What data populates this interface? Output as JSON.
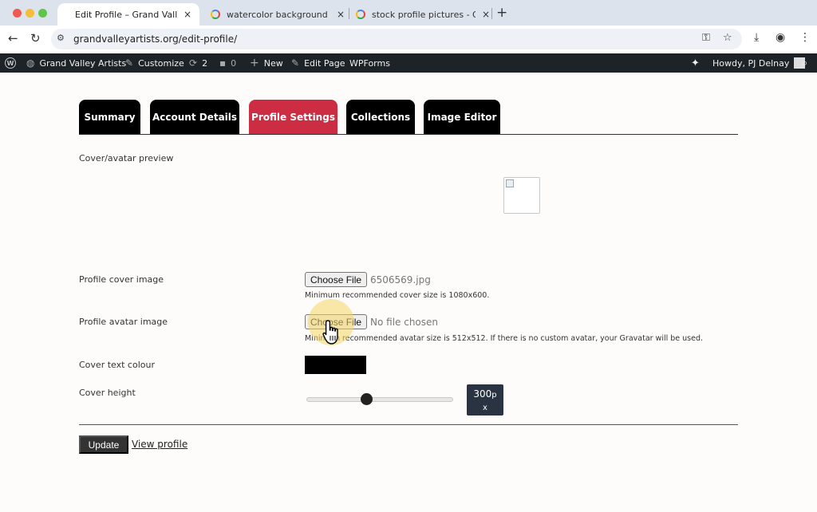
{
  "browser": {
    "tabs": [
      {
        "title": "Edit Profile – Grand Valley Artists",
        "close": "×"
      },
      {
        "title": "watercolor background images",
        "close": "×"
      },
      {
        "title": "stock profile pictures - Google",
        "close": "×"
      }
    ],
    "new_tab": "+",
    "url": "grandvalleyartists.org/edit-profile/",
    "icons": {
      "back": "←",
      "reload": "↻",
      "site_info": "⚙",
      "key": "⚿",
      "star": "☆",
      "download": "⤓",
      "profile": "◉",
      "menu": "⋮"
    }
  },
  "adminbar": {
    "site_name": "Grand Valley Artists",
    "customize": "Customize",
    "updates_count": "2",
    "comments_count": "0",
    "new": "New",
    "edit_page": "Edit Page",
    "wpforms": "WPForms",
    "howdy": "Howdy, PJ Delnay",
    "icons": {
      "wp": "W",
      "dashboard": "◍",
      "brush": "✎",
      "updates": "⟳",
      "comments": "▪",
      "plus": "+",
      "pencil": "✎",
      "sparkle": "✦",
      "search": "⌕"
    }
  },
  "profile_tabs": [
    {
      "label": "Summary",
      "active": false
    },
    {
      "label": "Account Details",
      "active": false
    },
    {
      "label": "Profile Settings",
      "active": true
    },
    {
      "label": "Collections",
      "active": false
    },
    {
      "label": "Image Editor",
      "active": false
    }
  ],
  "form": {
    "preview_label": "Cover/avatar preview",
    "cover_label": "Profile cover image",
    "cover_button": "Choose File",
    "cover_file": "6506569.jpg",
    "cover_hint": "Minimum recommended cover size is 1080x600.",
    "avatar_label": "Profile avatar image",
    "avatar_button": "Choose File",
    "avatar_file": "No file chosen",
    "avatar_hint": "Minimum recommended avatar size is 512x512. If there is no custom avatar, your Gravatar will be used.",
    "text_colour_label": "Cover text colour",
    "text_colour_value": "#000000",
    "height_label": "Cover height",
    "height_value": "300",
    "height_unit_a": "p",
    "height_unit_b": "x",
    "slider_fraction": 0.41
  },
  "actions": {
    "update": "Update",
    "view_profile": "View profile"
  },
  "colors": {
    "active_tab": "#cd2d43",
    "tab_bg": "#000000",
    "adminbar": "#1d2327",
    "badge": "#2a3342"
  }
}
